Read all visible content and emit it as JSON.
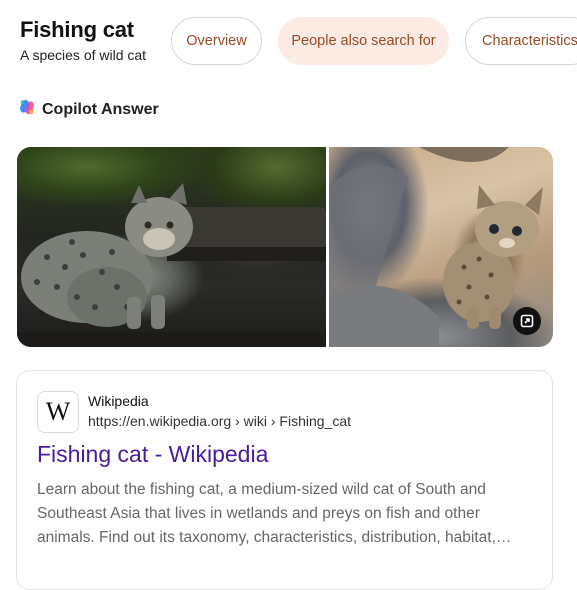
{
  "entity": {
    "title": "Fishing cat",
    "subtitle": "A species of wild cat"
  },
  "tabs": [
    {
      "label": "Overview",
      "active": false
    },
    {
      "label": "People also search for",
      "active": true
    },
    {
      "label": "Characteristics",
      "active": false
    }
  ],
  "copilot": {
    "label": "Copilot Answer",
    "icon": "copilot-logo-icon"
  },
  "images": [
    {
      "alt": "Adult fishing cat standing on dark ground"
    },
    {
      "alt": "Fishing cat kitten sitting on rocks"
    }
  ],
  "expand_icon": "expand-image-icon",
  "result": {
    "favicon_letter": "W",
    "source_name": "Wikipedia",
    "url": "https://en.wikipedia.org › wiki › Fishing_cat",
    "title": "Fishing cat - Wikipedia",
    "snippet": "Learn about the fishing cat, a medium-sized wild cat of South and Southeast Asia that lives in wetlands and preys on fish and other animals. Find out its taxonomy, characteristics, distribution, habitat, behaviour and conservation status."
  },
  "colors": {
    "tab_text": "#9a4a24",
    "tab_active_bg": "#fcebe3",
    "link_title": "#4a1aa0"
  }
}
